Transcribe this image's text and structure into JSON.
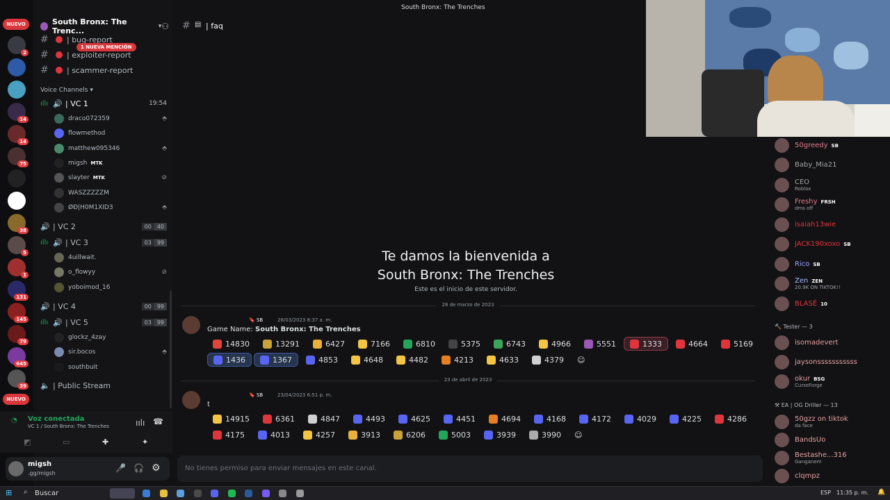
{
  "window_title": "South Bronx: The Trenches",
  "server": {
    "name": "South Bronx: The Trenc...",
    "new_badge": "NUEVO",
    "mention_badge": "1 NUEVA MENCIÓN"
  },
  "rail": [
    {
      "color": "#3a3a42",
      "badge": "2"
    },
    {
      "color": "#2f5aa8",
      "badge": ""
    },
    {
      "color": "#4aa0c0",
      "badge": ""
    },
    {
      "color": "#3a2a4a",
      "badge": "14"
    },
    {
      "color": "#6a2a2a",
      "badge": "14"
    },
    {
      "color": "#4a3030",
      "badge": "75"
    },
    {
      "color": "#222",
      "badge": ""
    },
    {
      "color": "#ffffff",
      "badge": ""
    },
    {
      "color": "#8a6a2a",
      "badge": "38"
    },
    {
      "color": "#5a4a4a",
      "badge": "5"
    },
    {
      "color": "#a03030",
      "badge": "1"
    },
    {
      "color": "#2a2a6a",
      "badge": "131"
    },
    {
      "color": "#8a2020",
      "badge": "145"
    },
    {
      "color": "#6a1a1a",
      "badge": "79"
    },
    {
      "color": "#7a3aa0",
      "badge": "645"
    },
    {
      "color": "#555",
      "badge": "39"
    }
  ],
  "channels": {
    "c1": "| bug-report",
    "c2": "| exploiter-report",
    "c3": "| scammer-report",
    "voice_header": "Voice Channels"
  },
  "vc1": {
    "name": "| VC 1",
    "time": "19:54",
    "users": [
      "draco072359",
      "flowmethod",
      "matthew095346",
      "migsh",
      "slayter",
      "WASZZZZZM",
      "ØĐ|H0M1XID3"
    ],
    "tag_mtk": "MTK"
  },
  "vc2": {
    "name": "| VC 2",
    "a": "00",
    "b": "40"
  },
  "vc3": {
    "name": "| VC 3",
    "a": "03",
    "b": "99",
    "users": [
      "4uillwait.",
      "o_flowyy",
      "yoboimod_16"
    ]
  },
  "vc4": {
    "name": "| VC 4",
    "a": "00",
    "b": "99"
  },
  "vc5": {
    "name": "| VC 5",
    "a": "03",
    "b": "99",
    "users": [
      "glockz_4zay",
      "sir.bocos",
      "southbuit"
    ]
  },
  "public_stream": "| Public Stream",
  "voice": {
    "status": "Voz conectada",
    "location": "VC 1 / South Bronx: The Trenches"
  },
  "user": {
    "name": "migsh",
    "sub": ".gg/migsh"
  },
  "channel_title": "| faq",
  "welcome": {
    "l1": "Te damos la bienvenida a",
    "l2": "South Bronx: The Trenches",
    "sub": "Este es el inicio de este servidor."
  },
  "date1": "28 de marzo de 2023",
  "msg1": {
    "tag": "SB",
    "time": "28/03/2023 8:37 a. m.",
    "label": "Game Name: ",
    "bold": "South Bronx: The Trenches"
  },
  "reacts1": [
    {
      "n": "14830",
      "c": "#e0453c"
    },
    {
      "n": "13291",
      "c": "#c9a23a"
    },
    {
      "n": "6427",
      "c": "#e8b23a"
    },
    {
      "n": "7166",
      "c": "#f4c542"
    },
    {
      "n": "6810",
      "c": "#23a55a"
    },
    {
      "n": "5375",
      "c": "#444"
    },
    {
      "n": "6743",
      "c": "#3ba55c"
    },
    {
      "n": "4966",
      "c": "#f4c542"
    },
    {
      "n": "5551",
      "c": "#9b59b6"
    },
    {
      "n": "1333",
      "c": "#e0353c",
      "s": 2
    },
    {
      "n": "4664",
      "c": "#e0353c"
    },
    {
      "n": "5169",
      "c": "#e0353c"
    },
    {
      "n": "1436",
      "c": "#5865f2",
      "s": 1
    },
    {
      "n": "1367",
      "c": "#5865f2",
      "s": 1
    },
    {
      "n": "4853",
      "c": "#5865f2"
    },
    {
      "n": "4648",
      "c": "#f4c542"
    },
    {
      "n": "4482",
      "c": "#f4c542"
    },
    {
      "n": "4213",
      "c": "#e67e22"
    },
    {
      "n": "4633",
      "c": "#f4c542"
    },
    {
      "n": "4379",
      "c": "#d0d0d0"
    }
  ],
  "date2": "23 de abril de 2023",
  "msg2": {
    "tag": "SB",
    "time": "23/04/2023 6:51 p. m.",
    "text": "t"
  },
  "reacts2": [
    {
      "n": "14915",
      "c": "#f4c542"
    },
    {
      "n": "6361",
      "c": "#e0353c"
    },
    {
      "n": "4847",
      "c": "#d0d0d0"
    },
    {
      "n": "4493",
      "c": "#5865f2"
    },
    {
      "n": "4625",
      "c": "#5865f2"
    },
    {
      "n": "4451",
      "c": "#5865f2"
    },
    {
      "n": "4694",
      "c": "#e67e22"
    },
    {
      "n": "4168",
      "c": "#5865f2"
    },
    {
      "n": "4172",
      "c": "#5865f2"
    },
    {
      "n": "4029",
      "c": "#5865f2"
    },
    {
      "n": "4225",
      "c": "#5865f2"
    },
    {
      "n": "4286",
      "c": "#e0353c"
    },
    {
      "n": "4175",
      "c": "#e0353c"
    },
    {
      "n": "4013",
      "c": "#5865f2"
    },
    {
      "n": "4257",
      "c": "#f4c542"
    },
    {
      "n": "3913",
      "c": "#e8b23a"
    },
    {
      "n": "6206",
      "c": "#c9a23a"
    },
    {
      "n": "5003",
      "c": "#23a55a"
    },
    {
      "n": "3939",
      "c": "#5865f2"
    },
    {
      "n": "3990",
      "c": "#aaa"
    }
  ],
  "input_placeholder": "No tienes permiso para enviar mensajes en este canal.",
  "members": [
    {
      "name": "50greedy",
      "tag": "SB",
      "color": "#e07a8a",
      "sub": ""
    },
    {
      "name": "Baby_Mia21",
      "tag": "",
      "color": "#a0a3a9",
      "sub": ""
    },
    {
      "name": "CEO",
      "tag": "",
      "color": "#a0a3a9",
      "sub": "Roblox"
    },
    {
      "name": "Freshy",
      "tag": "FRSH",
      "color": "#e07a8a",
      "sub": "dms off"
    },
    {
      "name": "isaiah13wie",
      "tag": "",
      "color": "#e0353c",
      "sub": ""
    },
    {
      "name": "JACK190xoxo",
      "tag": "SB",
      "color": "#e0353c",
      "sub": ""
    },
    {
      "name": "Rico",
      "tag": "SB",
      "color": "#a0a3ff",
      "sub": ""
    },
    {
      "name": "Zen",
      "tag": "ZEN",
      "color": "#a0c0ff",
      "sub": "20.9K ON TIKTOK!!"
    },
    {
      "name": "BLASÉ",
      "tag": "10",
      "color": "#e0353c",
      "sub": ""
    }
  ],
  "group_tester": "Tester — 3",
  "members2": [
    {
      "name": "isomadevert",
      "tag": "",
      "color": "#e8a0a0",
      "sub": ""
    },
    {
      "name": "jaysonsssssssssss",
      "tag": "",
      "color": "#e8a0a0",
      "sub": ""
    },
    {
      "name": "okur",
      "tag": "BSG",
      "color": "#e8a0a0",
      "sub": "CurseForge"
    }
  ],
  "group_ea": "EA | OG Driller — 13",
  "members3": [
    {
      "name": "50gzz on tiktok",
      "color": "#e8a0a0",
      "sub": "da face"
    },
    {
      "name": "BandsUo",
      "color": "#e8a0a0",
      "sub": ""
    },
    {
      "name": "Bestashe...316",
      "color": "#e8a0a0",
      "sub": "Ganganem"
    },
    {
      "name": "clqmpz",
      "color": "#e8a0a0",
      "sub": ""
    }
  ],
  "taskbar": {
    "search": "Buscar",
    "lang": "ESP",
    "time": "11:35 p. m."
  }
}
